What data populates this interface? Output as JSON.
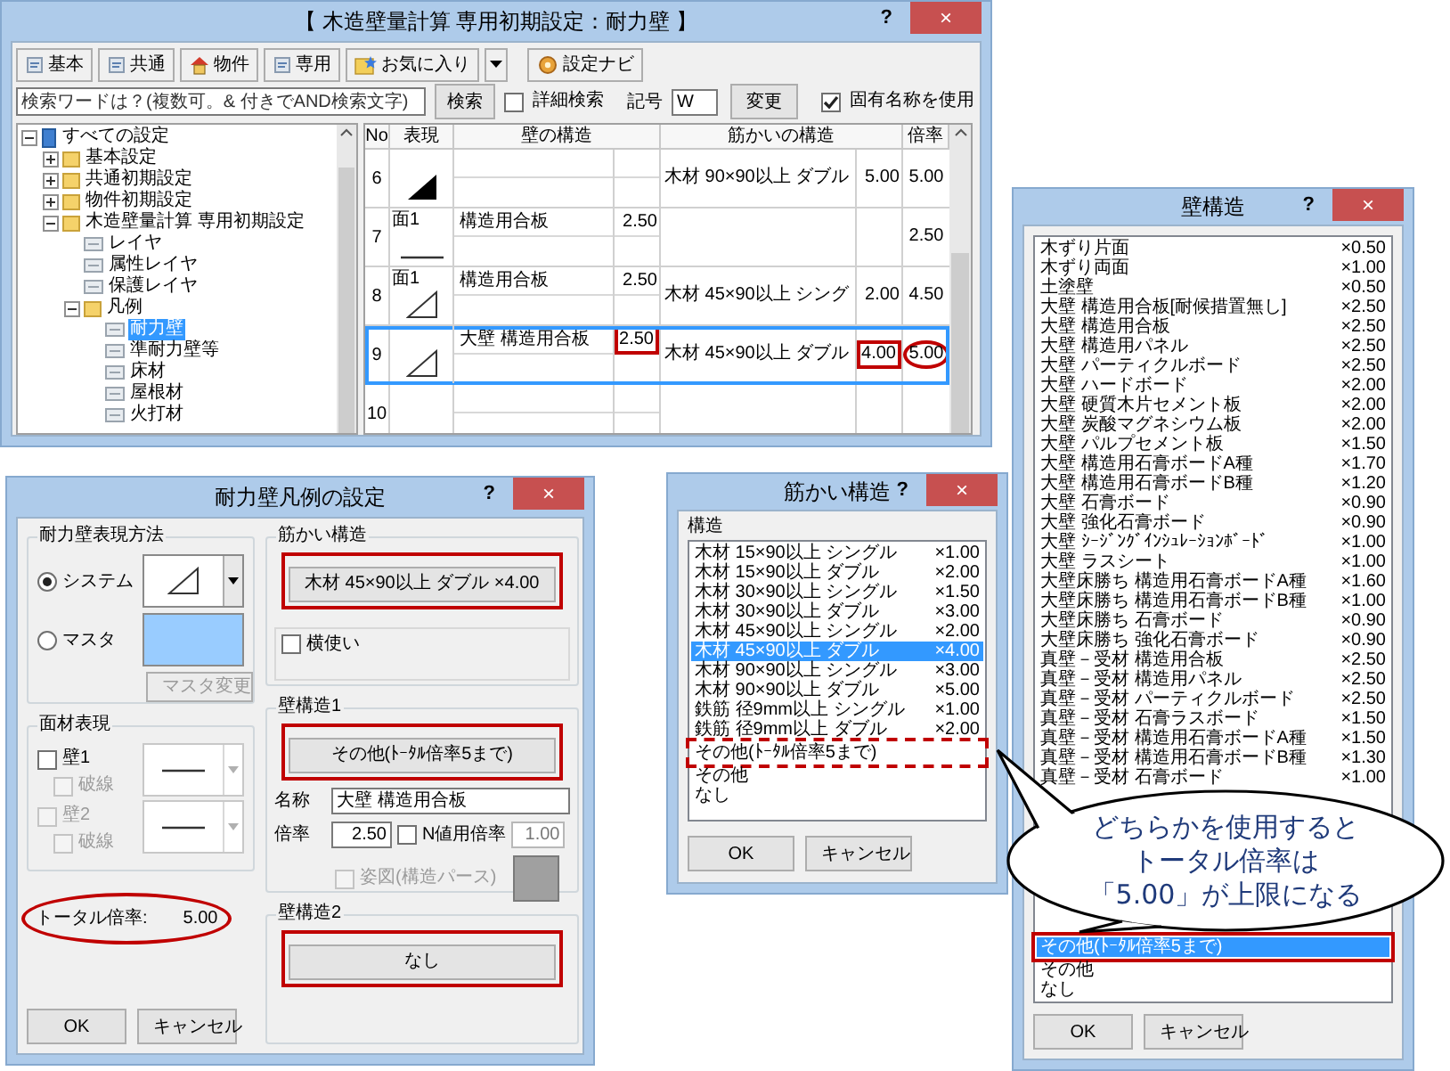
{
  "main_window": {
    "title": "【 木造壁量計算 専用初期設定：耐力壁 】",
    "title_buttons": [
      "?",
      "×"
    ],
    "toolbar": [
      {
        "label": "基本",
        "kind": "page"
      },
      {
        "label": "共通",
        "kind": "page"
      },
      {
        "label": "物件",
        "kind": "house"
      },
      {
        "label": "専用",
        "kind": "page"
      },
      {
        "label": "お気に入り",
        "kind": "star"
      }
    ],
    "navi_button": "設定ナビ",
    "search": {
      "placeholder": "検索ワードは？(複数可。& 付きでAND検索文字)",
      "button": "検索"
    },
    "detail_search": {
      "label": "詳細検索",
      "checked": false
    },
    "symbol": {
      "label": "記号",
      "value": "W"
    },
    "change_button": "変更",
    "proper_name": {
      "label": "固有名称を使用",
      "checked": true
    },
    "tree": [
      {
        "label": "すべての設定",
        "expanded": true,
        "selected": false,
        "children": [
          {
            "label": "基本設定",
            "expanded": false,
            "selected": false
          },
          {
            "label": "共通初期設定",
            "expanded": false,
            "selected": false
          },
          {
            "label": "物件初期設定",
            "expanded": false,
            "selected": false
          },
          {
            "label": "木造壁量計算 専用初期設定",
            "expanded": true,
            "selected": false,
            "children": [
              {
                "label": "レイヤ",
                "selected": false
              },
              {
                "label": "属性レイヤ",
                "selected": false
              },
              {
                "label": "保護レイヤ",
                "selected": false
              },
              {
                "label": "凡例",
                "expanded": true,
                "selected": false,
                "children": [
                  {
                    "label": "耐力壁",
                    "selected": true
                  },
                  {
                    "label": "準耐力壁等",
                    "selected": false
                  },
                  {
                    "label": "床材",
                    "selected": false
                  },
                  {
                    "label": "屋根材",
                    "selected": false
                  },
                  {
                    "label": "火打材",
                    "selected": false
                  }
                ]
              }
            ]
          }
        ]
      }
    ],
    "table": {
      "columns": [
        "No",
        "表現",
        "壁の構造",
        "筋かいの構造",
        "倍率"
      ],
      "rows": [
        {
          "no": "6",
          "kind": "solid-triangle",
          "brace": "木材 90×90以上 ダブル",
          "brace_rate": "5.00",
          "rate": "5.00",
          "selected": false
        },
        {
          "no": "7",
          "face": "面1",
          "kind": "line",
          "wall": "構造用合板",
          "wall_rate": "2.50",
          "rate": "2.50",
          "selected": false
        },
        {
          "no": "8",
          "face": "面1",
          "kind": "open-triangle",
          "wall": "構造用合板",
          "wall_rate": "2.50",
          "brace": "木材 45×90以上 シング",
          "brace_rate": "2.00",
          "rate": "4.50",
          "selected": false
        },
        {
          "no": "9",
          "kind": "open-triangle",
          "wall": "大壁 構造用合板",
          "wall_rate": "2.50",
          "wall_rate_marked": true,
          "brace": "木材 45×90以上 ダブル",
          "brace_rate": "4.00",
          "brace_rate_marked": true,
          "rate": "5.00",
          "rate_marked": true,
          "selected": true
        },
        {
          "no": "10",
          "selected": false
        }
      ]
    }
  },
  "legend_dialog": {
    "title": "耐力壁凡例の設定",
    "title_buttons": [
      "?",
      "×"
    ],
    "method": {
      "title": "耐力壁表現方法",
      "options": [
        {
          "label": "システム",
          "selected": true
        },
        {
          "label": "マスタ",
          "selected": false
        }
      ],
      "master_button": {
        "label": "マスタ変更",
        "disabled": true
      }
    },
    "brace": {
      "title": "筋かい構造",
      "button": "木材 45×90以上 ダブル ×4.00",
      "marked": true,
      "horizontal": {
        "label": "横使い",
        "checked": false
      }
    },
    "face": {
      "title": "面材表現",
      "walls": [
        {
          "label": "壁1",
          "checked": false,
          "disabled": false,
          "dashed": {
            "label": "破線",
            "checked": false,
            "disabled": true
          }
        },
        {
          "label": "壁2",
          "checked": false,
          "disabled": true,
          "dashed": {
            "label": "破線",
            "checked": false,
            "disabled": true
          }
        }
      ]
    },
    "total": {
      "label": "トータル倍率:",
      "value": "5.00",
      "marked": true
    },
    "wall1": {
      "title": "壁構造1",
      "button": "その他(ﾄｰﾀﾙ倍率5まで)",
      "marked": true,
      "name_label": "名称",
      "name_value": "大壁 構造用合板",
      "rate_label": "倍率",
      "rate_value": "2.50",
      "n_rate": {
        "label": "N値用倍率",
        "checked": false
      },
      "n_rate_value": "1.00",
      "figure": {
        "label": "姿図(構造パース)",
        "checked": false,
        "disabled": true
      }
    },
    "wall2": {
      "title": "壁構造2",
      "button": "なし",
      "marked": true
    },
    "buttons": [
      "OK",
      "キャンセル"
    ]
  },
  "brace_dialog": {
    "title": "筋かい構造",
    "title_buttons": [
      "?",
      "×"
    ],
    "list_label": "構造",
    "items": [
      {
        "text": "木材 15×90以上 シングル",
        "rate": "×1.00",
        "selected": false
      },
      {
        "text": "木材 15×90以上 ダブル",
        "rate": "×2.00",
        "selected": false
      },
      {
        "text": "木材 30×90以上 シングル",
        "rate": "×1.50",
        "selected": false
      },
      {
        "text": "木材 30×90以上 ダブル",
        "rate": "×3.00",
        "selected": false
      },
      {
        "text": "木材 45×90以上 シングル",
        "rate": "×2.00",
        "selected": false
      },
      {
        "text": "木材 45×90以上 ダブル",
        "rate": "×4.00",
        "selected": true
      },
      {
        "text": "木材 90×90以上 シングル",
        "rate": "×3.00",
        "selected": false
      },
      {
        "text": "木材 90×90以上 ダブル",
        "rate": "×5.00",
        "selected": false
      },
      {
        "text": "鉄筋 径9mm以上 シングル",
        "rate": "×1.00",
        "selected": false
      },
      {
        "text": "鉄筋 径9mm以上 ダブル",
        "rate": "×2.00",
        "selected": false
      },
      {
        "text": "その他(ﾄｰﾀﾙ倍率5まで)",
        "selected": false,
        "marked": true
      },
      {
        "text": "その他",
        "selected": false
      },
      {
        "text": "なし",
        "selected": false
      }
    ],
    "buttons": [
      "OK",
      "キャンセル"
    ]
  },
  "wall_dialog": {
    "title": "壁構造",
    "title_buttons": [
      "?",
      "×"
    ],
    "items_top": [
      {
        "text": "木ずり片面",
        "rate": "×0.50",
        "selected": false
      },
      {
        "text": "木ずり両面",
        "rate": "×1.00",
        "selected": false
      },
      {
        "text": "土塗壁",
        "rate": "×0.50",
        "selected": false
      },
      {
        "text": "大壁 構造用合板[耐候措置無し]",
        "rate": "×2.50",
        "selected": false
      },
      {
        "text": "大壁 構造用合板",
        "rate": "×2.50",
        "selected": false
      },
      {
        "text": "大壁 構造用パネル",
        "rate": "×2.50",
        "selected": false
      },
      {
        "text": "大壁 パーティクルボード",
        "rate": "×2.50",
        "selected": false
      },
      {
        "text": "大壁 ハードボード",
        "rate": "×2.00",
        "selected": false
      },
      {
        "text": "大壁 硬質木片セメント板",
        "rate": "×2.00",
        "selected": false
      },
      {
        "text": "大壁 炭酸マグネシウム板",
        "rate": "×2.00",
        "selected": false
      },
      {
        "text": "大壁 パルプセメント板",
        "rate": "×1.50",
        "selected": false
      },
      {
        "text": "大壁 構造用石膏ボードA種",
        "rate": "×1.70",
        "selected": false
      },
      {
        "text": "大壁 構造用石膏ボードB種",
        "rate": "×1.20",
        "selected": false
      },
      {
        "text": "大壁 石膏ボード",
        "rate": "×0.90",
        "selected": false
      },
      {
        "text": "大壁 強化石膏ボード",
        "rate": "×0.90",
        "selected": false
      },
      {
        "text": "大壁 ｼｰｼﾞﾝｸﾞｲﾝｼｭﾚｰｼｮﾝﾎﾞｰﾄﾞ",
        "rate": "×1.00",
        "selected": false
      },
      {
        "text": "大壁 ラスシート",
        "rate": "×1.00",
        "selected": false
      },
      {
        "text": "大壁床勝ち 構造用石膏ボードA種",
        "rate": "×1.60",
        "selected": false
      },
      {
        "text": "大壁床勝ち 構造用石膏ボードB種",
        "rate": "×1.00",
        "selected": false
      },
      {
        "text": "大壁床勝ち 石膏ボード",
        "rate": "×0.90",
        "selected": false
      },
      {
        "text": "大壁床勝ち 強化石膏ボード",
        "rate": "×0.90",
        "selected": false
      },
      {
        "text": "真壁－受材 構造用合板",
        "rate": "×2.50",
        "selected": false
      },
      {
        "text": "真壁－受材 構造用パネル",
        "rate": "×2.50",
        "selected": false
      },
      {
        "text": "真壁－受材 パーティクルボード",
        "rate": "×2.50",
        "selected": false
      },
      {
        "text": "真壁－受材 石膏ラスボード",
        "rate": "×1.50",
        "selected": false
      },
      {
        "text": "真壁－受材 構造用石膏ボードA種",
        "rate": "×1.50",
        "selected": false
      },
      {
        "text": "真壁－受材 構造用石膏ボードB種",
        "rate": "×1.30",
        "selected": false
      },
      {
        "text": "真壁－受材 石膏ボード",
        "rate": "×1.00",
        "selected": false
      }
    ],
    "items_bottom": [
      {
        "text": "その他(ﾄｰﾀﾙ倍率5まで)",
        "selected": true,
        "marked": true
      },
      {
        "text": "その他",
        "selected": false
      },
      {
        "text": "なし",
        "selected": false
      }
    ],
    "buttons": [
      "OK",
      "キャンセル"
    ]
  },
  "callout": {
    "lines": [
      "どちらかを使用すると",
      "トータル倍率は",
      "「5.00」が上限になる"
    ]
  }
}
